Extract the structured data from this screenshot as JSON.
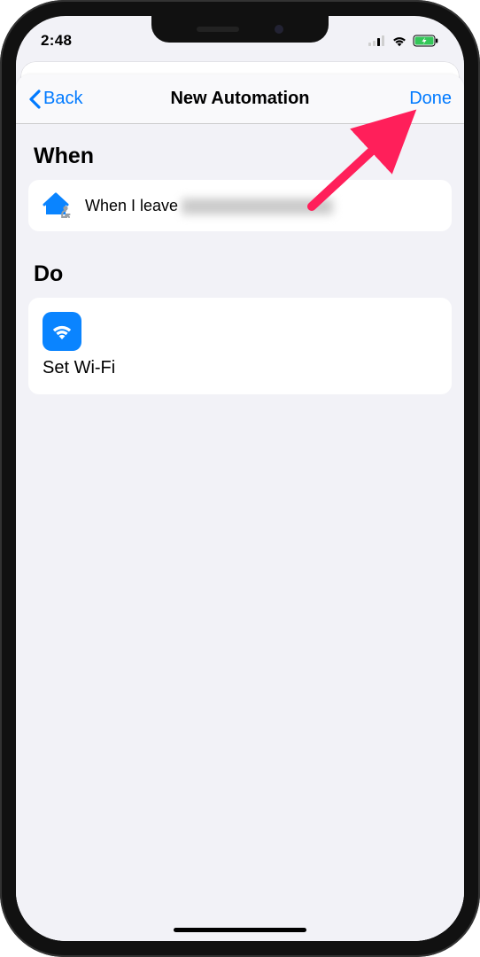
{
  "status": {
    "time": "2:48"
  },
  "nav": {
    "back": "Back",
    "title": "New Automation",
    "done": "Done"
  },
  "sections": {
    "when_header": "When",
    "when_text": "When I leave",
    "do_header": "Do",
    "action_label": "Set Wi-Fi"
  }
}
